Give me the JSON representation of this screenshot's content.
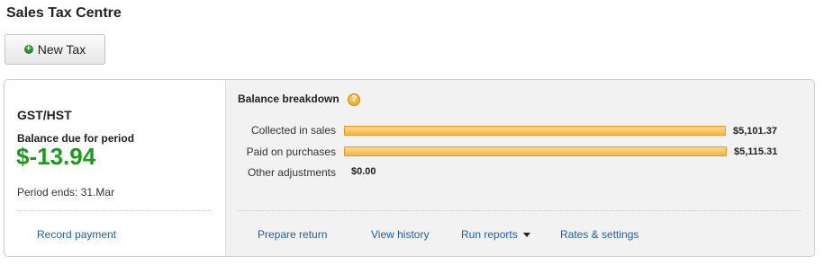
{
  "header": {
    "title": "Sales Tax Centre"
  },
  "toolbar": {
    "new_tax_label": "New Tax"
  },
  "tax_card": {
    "name": "GST/HST",
    "balance_label": "Balance due for period",
    "balance_amount": "$-13.94",
    "period_ends": "Period ends: 31.Mar",
    "record_payment_label": "Record payment",
    "breakdown": {
      "title": "Balance breakdown",
      "rows": [
        {
          "label": "Collected in sales",
          "value": "$5,101.37",
          "amount": 5101.37
        },
        {
          "label": "Paid on purchases",
          "value": "$5,115.31",
          "amount": 5115.31
        },
        {
          "label": "Other adjustments",
          "value": "$0.00",
          "amount": 0
        }
      ]
    },
    "actions": {
      "prepare_return": "Prepare return",
      "view_history": "View history",
      "run_reports": "Run reports",
      "rates_settings": "Rates & settings"
    }
  },
  "colors": {
    "balance_green": "#1a9c1a",
    "link_blue": "#1f5fa8",
    "bar_orange": "#f5b44a"
  }
}
